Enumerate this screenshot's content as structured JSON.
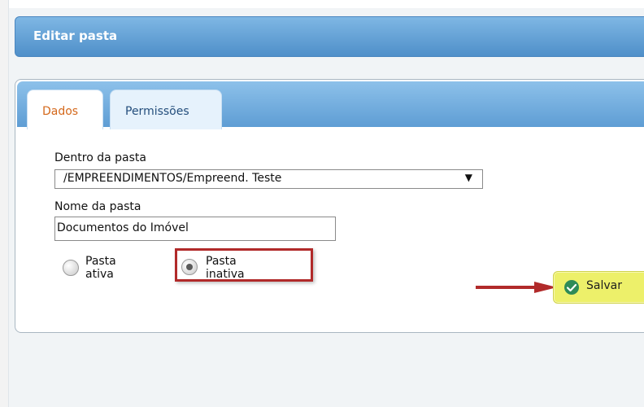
{
  "window": {
    "title": "Editar pasta"
  },
  "tabs": [
    {
      "label": "Dados",
      "active": true
    },
    {
      "label": "Permissões",
      "active": false
    }
  ],
  "form": {
    "folder_parent": {
      "label": "Dentro da pasta",
      "selected_value": "/EMPREENDIMENTOS/Empreend. Teste"
    },
    "folder_name": {
      "label": "Nome da pasta",
      "value": "Documentos do Imóvel"
    },
    "status": {
      "options": [
        {
          "label": "Pasta ativa",
          "selected": false
        },
        {
          "label": "Pasta inativa",
          "selected": true
        }
      ]
    }
  },
  "actions": {
    "save_label": "Salvar"
  },
  "icons": {
    "save": "check-circle-icon",
    "select_arrow": "chevron-down-icon",
    "annotation_arrow": "red-arrow-icon"
  },
  "colors": {
    "header_blue": "#5d9bd2",
    "tab_active_text": "#d4681b",
    "highlight_red": "#b12a2a",
    "save_button_yellow": "#edf06a"
  }
}
